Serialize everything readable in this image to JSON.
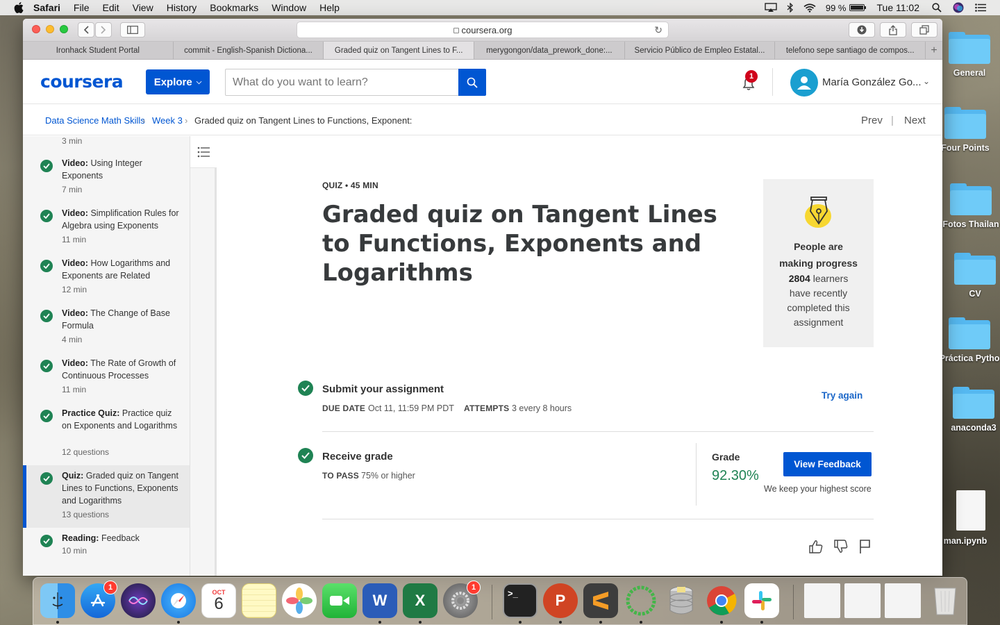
{
  "menubar": {
    "app": "Safari",
    "items": [
      "File",
      "Edit",
      "View",
      "History",
      "Bookmarks",
      "Window",
      "Help"
    ],
    "battery": "99 %",
    "clock": "Tue 11:02"
  },
  "browser": {
    "url": "coursera.org",
    "tabs": [
      "Ironhack Student Portal",
      "commit - English-Spanish Dictiona...",
      "Graded quiz on Tangent Lines to F...",
      "merygongon/data_prework_done:...",
      "Servicio Público de Empleo Estatal...",
      "telefono sepe santiago de compos..."
    ],
    "active_tab": 2,
    "new_tab": "+"
  },
  "header": {
    "logo": "coursera",
    "explore": "Explore",
    "search_placeholder": "What do you want to learn?",
    "notifications": "1",
    "username": "María González Go..."
  },
  "breadcrumb": {
    "course": "Data Science Math Skills",
    "week": "Week 3",
    "current": "Graded quiz on Tangent Lines to Functions, Exponent:",
    "prev": "Prev",
    "sep": "|",
    "next": "Next"
  },
  "sidebar": {
    "top_partial_meta": "3 min",
    "items": [
      {
        "type": "Video:",
        "title": "Using Integer Exponents",
        "meta": "7 min"
      },
      {
        "type": "Video:",
        "title": "Simplification Rules for Algebra using Exponents",
        "meta": "11 min"
      },
      {
        "type": "Video:",
        "title": "How Logarithms and Exponents are Related",
        "meta": "12 min"
      },
      {
        "type": "Video:",
        "title": "The Change of Base Formula",
        "meta": "4 min"
      },
      {
        "type": "Video:",
        "title": "The Rate of Growth of Continuous Processes",
        "meta": "11 min"
      },
      {
        "type": "Practice Quiz:",
        "title": "Practice quiz on Exponents and Logarithms",
        "meta": "12 questions"
      },
      {
        "type": "Quiz:",
        "title": "Graded quiz on Tangent Lines to Functions, Exponents and Logarithms",
        "meta": "13 questions"
      },
      {
        "type": "Reading:",
        "title": "Feedback",
        "meta": "10 min"
      }
    ]
  },
  "quiz": {
    "label": "QUIZ • 45 MIN",
    "title": "Graded quiz on Tangent Lines to Functions, Exponents and Logarithms",
    "progress_title_1": "People are",
    "progress_title_2": "making progress",
    "learners_count": "2804",
    "learners_rest": " learners",
    "progress_line_2": "have recently",
    "progress_line_3": "completed this",
    "progress_line_4": "assignment",
    "submit_title": "Submit your assignment",
    "due_key": "DUE DATE",
    "due_val": "Oct 11, 11:59 PM PDT",
    "attempts_key": "ATTEMPTS",
    "attempts_val": "3 every 8 hours",
    "try_again": "Try again",
    "receive_title": "Receive grade",
    "pass_key": "TO PASS",
    "pass_val": "75% or higher",
    "grade_label": "Grade",
    "grade_value": "92.30%",
    "view_feedback": "View Feedback",
    "keep_score": "We keep your highest score"
  },
  "desktop": {
    "icons": [
      "General",
      "Four Points",
      "Fotos Thailan",
      "CV",
      "Práctica Pytho",
      "anaconda3",
      "man.ipynb"
    ]
  },
  "dock": {
    "calendar_month": "OCT",
    "calendar_day": "6",
    "appstore_badge": "1",
    "settings_badge": "1",
    "terminal_prompt": ">_"
  },
  "colors": {
    "coursera_blue": "#0056d2",
    "success_green": "#1f8354",
    "notification_red": "#d0021b"
  }
}
